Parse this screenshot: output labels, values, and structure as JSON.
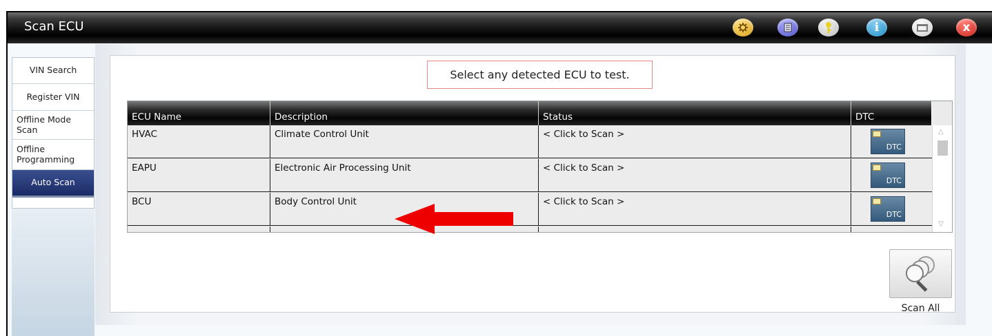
{
  "window": {
    "title": "Scan ECU",
    "toolbar_icons": [
      "settings-icon",
      "document-icon",
      "key-icon",
      "info-icon",
      "window-icon",
      "close-icon"
    ],
    "info_glyph": "i",
    "close_glyph": "x"
  },
  "sidebar": {
    "items": [
      {
        "label": "VIN Search"
      },
      {
        "label": "Register VIN"
      },
      {
        "label": "Offline Mode Scan"
      },
      {
        "label": "Offline Programming"
      },
      {
        "label": "Auto Scan",
        "active": true
      }
    ]
  },
  "main": {
    "instruction": "Select any detected ECU to test.",
    "table": {
      "headers": [
        "ECU Name",
        "Description",
        "Status",
        "DTC"
      ],
      "rows": [
        {
          "name": "HVAC",
          "description": "Climate Control Unit",
          "status": "< Click to Scan >",
          "dtc": "DTC"
        },
        {
          "name": "EAPU",
          "description": "Electronic Air Processing Unit",
          "status": "< Click to Scan >",
          "dtc": "DTC"
        },
        {
          "name": "BCU",
          "description": "Body Control Unit",
          "status": "< Click to Scan >",
          "dtc": "DTC"
        }
      ]
    },
    "scan_all_label": "Scan All"
  },
  "colors": {
    "active_tab": "#1a2a66",
    "arrow": "#ee0000",
    "notice_border": "#e48a8a",
    "dtc_button": "#345a7c"
  }
}
